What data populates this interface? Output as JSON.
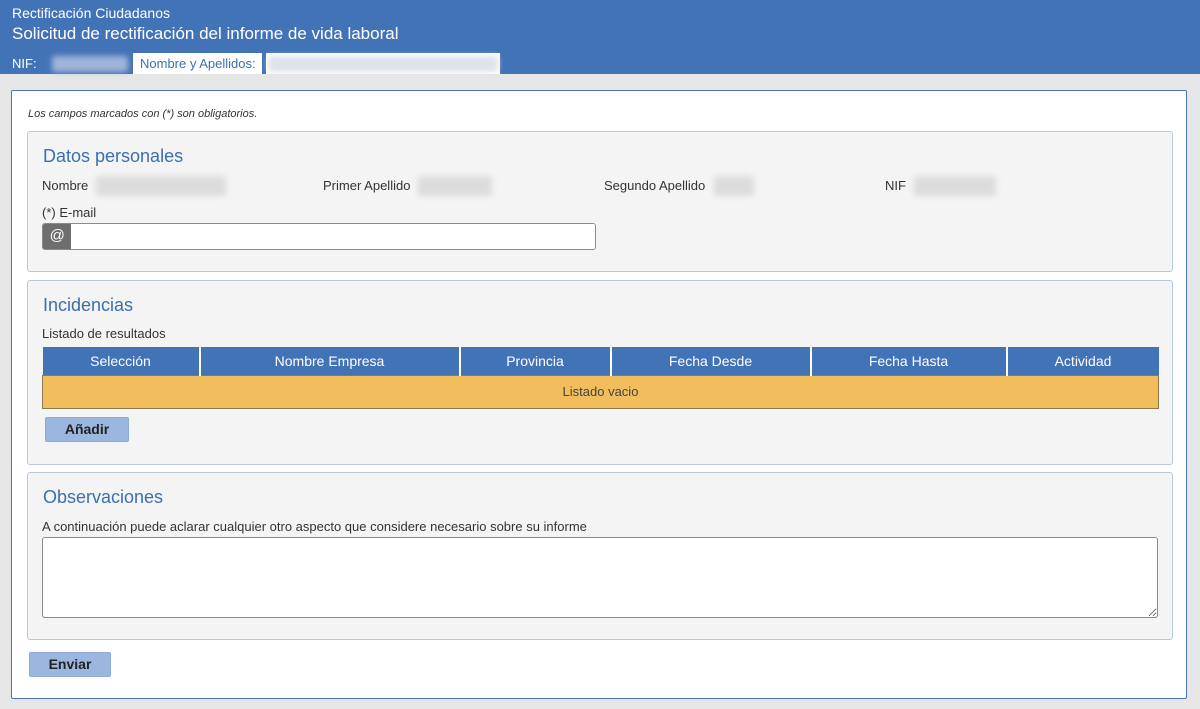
{
  "header": {
    "app_name": "Rectificación Ciudadanos",
    "title": "Solicitud de rectificación del informe de vida laboral"
  },
  "userbar": {
    "nif_label": "NIF:",
    "name_label": "Nombre y Apellidos:"
  },
  "form": {
    "required_note": "Los campos marcados con (*) son obligatorios.",
    "personal": {
      "title": "Datos personales",
      "nombre_label": "Nombre",
      "primer_apellido_label": "Primer Apellido",
      "segundo_apellido_label": "Segundo Apellido",
      "nif_label": "NIF",
      "email_label": "(*) E-mail",
      "email_prefix": "@",
      "email_value": ""
    },
    "incidencias": {
      "title": "Incidencias",
      "list_label": "Listado de resultados",
      "columns": [
        "Selección",
        "Nombre Empresa",
        "Provincia",
        "Fecha Desde",
        "Fecha Hasta",
        "Actividad"
      ],
      "empty_text": "Listado vacio",
      "add_button": "Añadir"
    },
    "observaciones": {
      "title": "Observaciones",
      "description": "A continuación puede aclarar cualquier otro aspecto que considere necesario sobre su informe",
      "value": ""
    },
    "submit_button": "Enviar"
  },
  "colors": {
    "brand_blue": "#4373b7",
    "empty_row": "#f2be5b",
    "button": "#9bb6df"
  }
}
